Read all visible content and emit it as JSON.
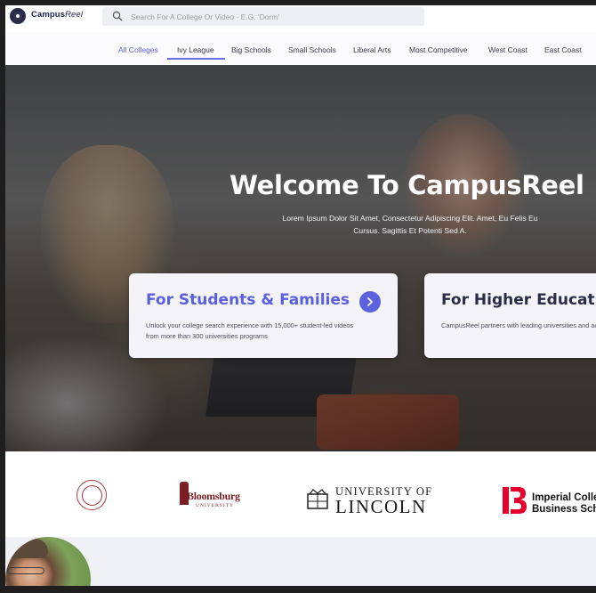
{
  "header": {
    "logo_main": "Campus",
    "logo_accent": "Reel",
    "search_placeholder": "Search For A College Or Video - E.G. 'Dorm'"
  },
  "nav": {
    "items": [
      {
        "label": "All Colleges",
        "active": true
      },
      {
        "label": "Ivy League",
        "active": false
      },
      {
        "label": "Big Schools",
        "active": false
      },
      {
        "label": "Small Schools",
        "active": false
      },
      {
        "label": "Liberal Arts",
        "active": false
      },
      {
        "label": "Most Competitive",
        "active": false
      },
      {
        "label": "West Coast",
        "active": false
      },
      {
        "label": "East Coast",
        "active": false
      }
    ]
  },
  "hero": {
    "title": "Welcome To CampusReel",
    "subtitle": "Lorem Ipsum Dolor Sit Amet, Consectetur Adipiscing Elit. Amet, Eu Felis Eu Cursus. Sagittis Et Potenti Sed A.",
    "cards": [
      {
        "title": "For Students & Families",
        "description": "Unlock your college search experience with 15,000+ student-led videos from more than 300 universities programs"
      },
      {
        "title": "For Higher Education",
        "description": "CampusReel partners with leading universities and across the world."
      }
    ]
  },
  "logos": {
    "bloomsburg": {
      "name": "Bloomsburg",
      "sub": "UNIVERSITY"
    },
    "lincoln": {
      "line1": "UNIVERSITY OF",
      "line2": "LINCOLN"
    },
    "imperial": {
      "line1": "Imperial College",
      "line2": "Business School"
    }
  },
  "colors": {
    "accent": "#5b63e0",
    "dark_text": "#2b2c4a",
    "imperial_red": "#e4002b",
    "bloomsburg_maroon": "#7b1e26"
  },
  "icons": {
    "logo": "campusreel-logo-icon",
    "search": "search-icon",
    "card_arrow": "chevron-right-icon"
  }
}
